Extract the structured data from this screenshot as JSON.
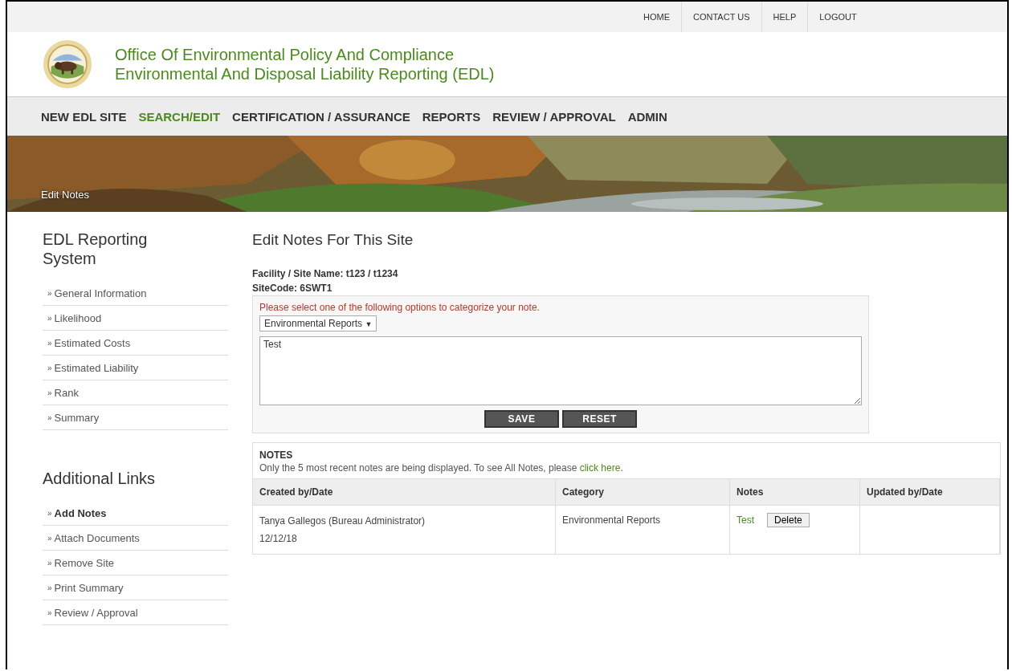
{
  "utility_nav": [
    {
      "label": "HOME"
    },
    {
      "label": "CONTACT US"
    },
    {
      "label": "HELP"
    },
    {
      "label": "LOGOUT"
    }
  ],
  "header": {
    "title_line_1": "Office Of Environmental Policy And Compliance",
    "title_line_2": "Environmental And Disposal Liability Reporting (EDL)"
  },
  "main_nav": [
    {
      "label": "NEW EDL SITE",
      "selected": false
    },
    {
      "label": "SEARCH/EDIT",
      "selected": true
    },
    {
      "label": "CERTIFICATION / ASSURANCE",
      "selected": false
    },
    {
      "label": "REPORTS",
      "selected": false
    },
    {
      "label": "REVIEW / APPROVAL",
      "selected": false
    },
    {
      "label": "ADMIN",
      "selected": false
    }
  ],
  "banner": {
    "kind": "picture",
    "caption": "Edit Notes"
  },
  "sidebar": {
    "sections": [
      {
        "title": "EDL Reporting System",
        "items": [
          {
            "bullet": "»",
            "label": "General Information",
            "selected": false
          },
          {
            "bullet": "»",
            "label": "Likelihood",
            "selected": false
          },
          {
            "bullet": "»",
            "label": "Estimated Costs",
            "selected": false
          },
          {
            "bullet": "»",
            "label": "Estimated Liability",
            "selected": false
          },
          {
            "bullet": "»",
            "label": "Rank",
            "selected": false
          },
          {
            "bullet": "»",
            "label": "Summary",
            "selected": false
          }
        ]
      },
      {
        "title": "Additional Links",
        "items": [
          {
            "bullet": "»",
            "label": "Add Notes",
            "selected": true
          },
          {
            "bullet": "»",
            "label": "Attach Documents",
            "selected": false
          },
          {
            "bullet": "»",
            "label": "Remove Site",
            "selected": false
          },
          {
            "bullet": "»",
            "label": "Print Summary",
            "selected": false
          },
          {
            "bullet": "»",
            "label": "Review / Approval",
            "selected": false
          }
        ]
      }
    ]
  },
  "page_title": "Edit Notes For This Site",
  "facility": "Facility / Site Name: t123 / t1234",
  "site_code": "SiteCode: 6SWT1",
  "note_form": {
    "instruction": "Please select one of the following options to categorize your note.",
    "category_select": {
      "value": "Environmental Reports",
      "arrow": "▼"
    },
    "note_text": {
      "value": "Test"
    },
    "buttons": [
      "SAVE",
      "RESET"
    ]
  },
  "notes": {
    "title": "NOTES",
    "message": "Only the 5 most recent notes are being displayed. To see All Notes, please",
    "link": "click here",
    "message_end": ".",
    "table": {
      "columns": [
        "Created by/Date",
        "Category",
        "Notes",
        "Updated by/Date"
      ],
      "rows": [
        {
          "created_by": "Tanya Gallegos (Bureau Administrator)",
          "date": "12/12/18",
          "category": "Environmental Reports",
          "note": "Test",
          "action": "Delete",
          "updated": ""
        }
      ]
    }
  }
}
